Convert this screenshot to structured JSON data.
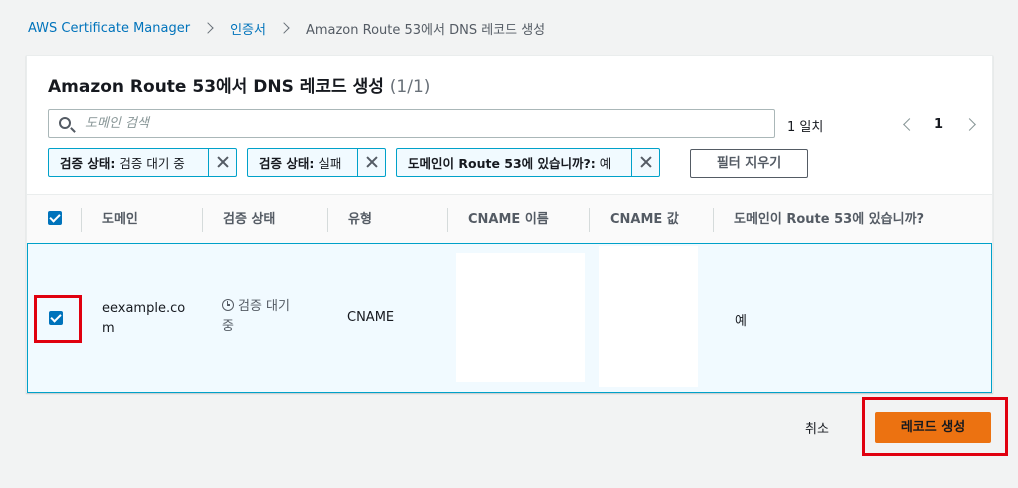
{
  "breadcrumb": {
    "items": [
      "AWS Certificate Manager",
      "인증서",
      "Amazon Route 53에서 DNS 레코드 생성"
    ]
  },
  "panel": {
    "title": "Amazon Route 53에서 DNS 레코드 생성",
    "count": "(1/1)"
  },
  "search": {
    "placeholder": "도메인 검색",
    "match_count": "1 일치"
  },
  "pagination": {
    "page": "1"
  },
  "filters": [
    {
      "key": "검증 상태:",
      "value": "검증 대기 중"
    },
    {
      "key": "검증 상태:",
      "value": "실패"
    },
    {
      "key": "도메인이 Route 53에 있습니까?:",
      "value": "예"
    }
  ],
  "clear_filters_label": "필터 지우기",
  "table": {
    "headers": [
      "도메인",
      "검증 상태",
      "유형",
      "CNAME 이름",
      "CNAME 값",
      "도메인이 Route 53에 있습니까?"
    ],
    "rows": [
      {
        "domain_line1": "eexample.co",
        "domain_line2": "m",
        "status_line1": "검증 대기",
        "status_line2": "중",
        "type": "CNAME",
        "in_route53": "예",
        "selected": true
      }
    ]
  },
  "footer": {
    "cancel_label": "취소",
    "create_label": "레코드 생성"
  },
  "colors": {
    "link": "#0073bb",
    "accent": "#00a1c9",
    "primary": "#ec7211",
    "highlight": "#e0000f"
  }
}
